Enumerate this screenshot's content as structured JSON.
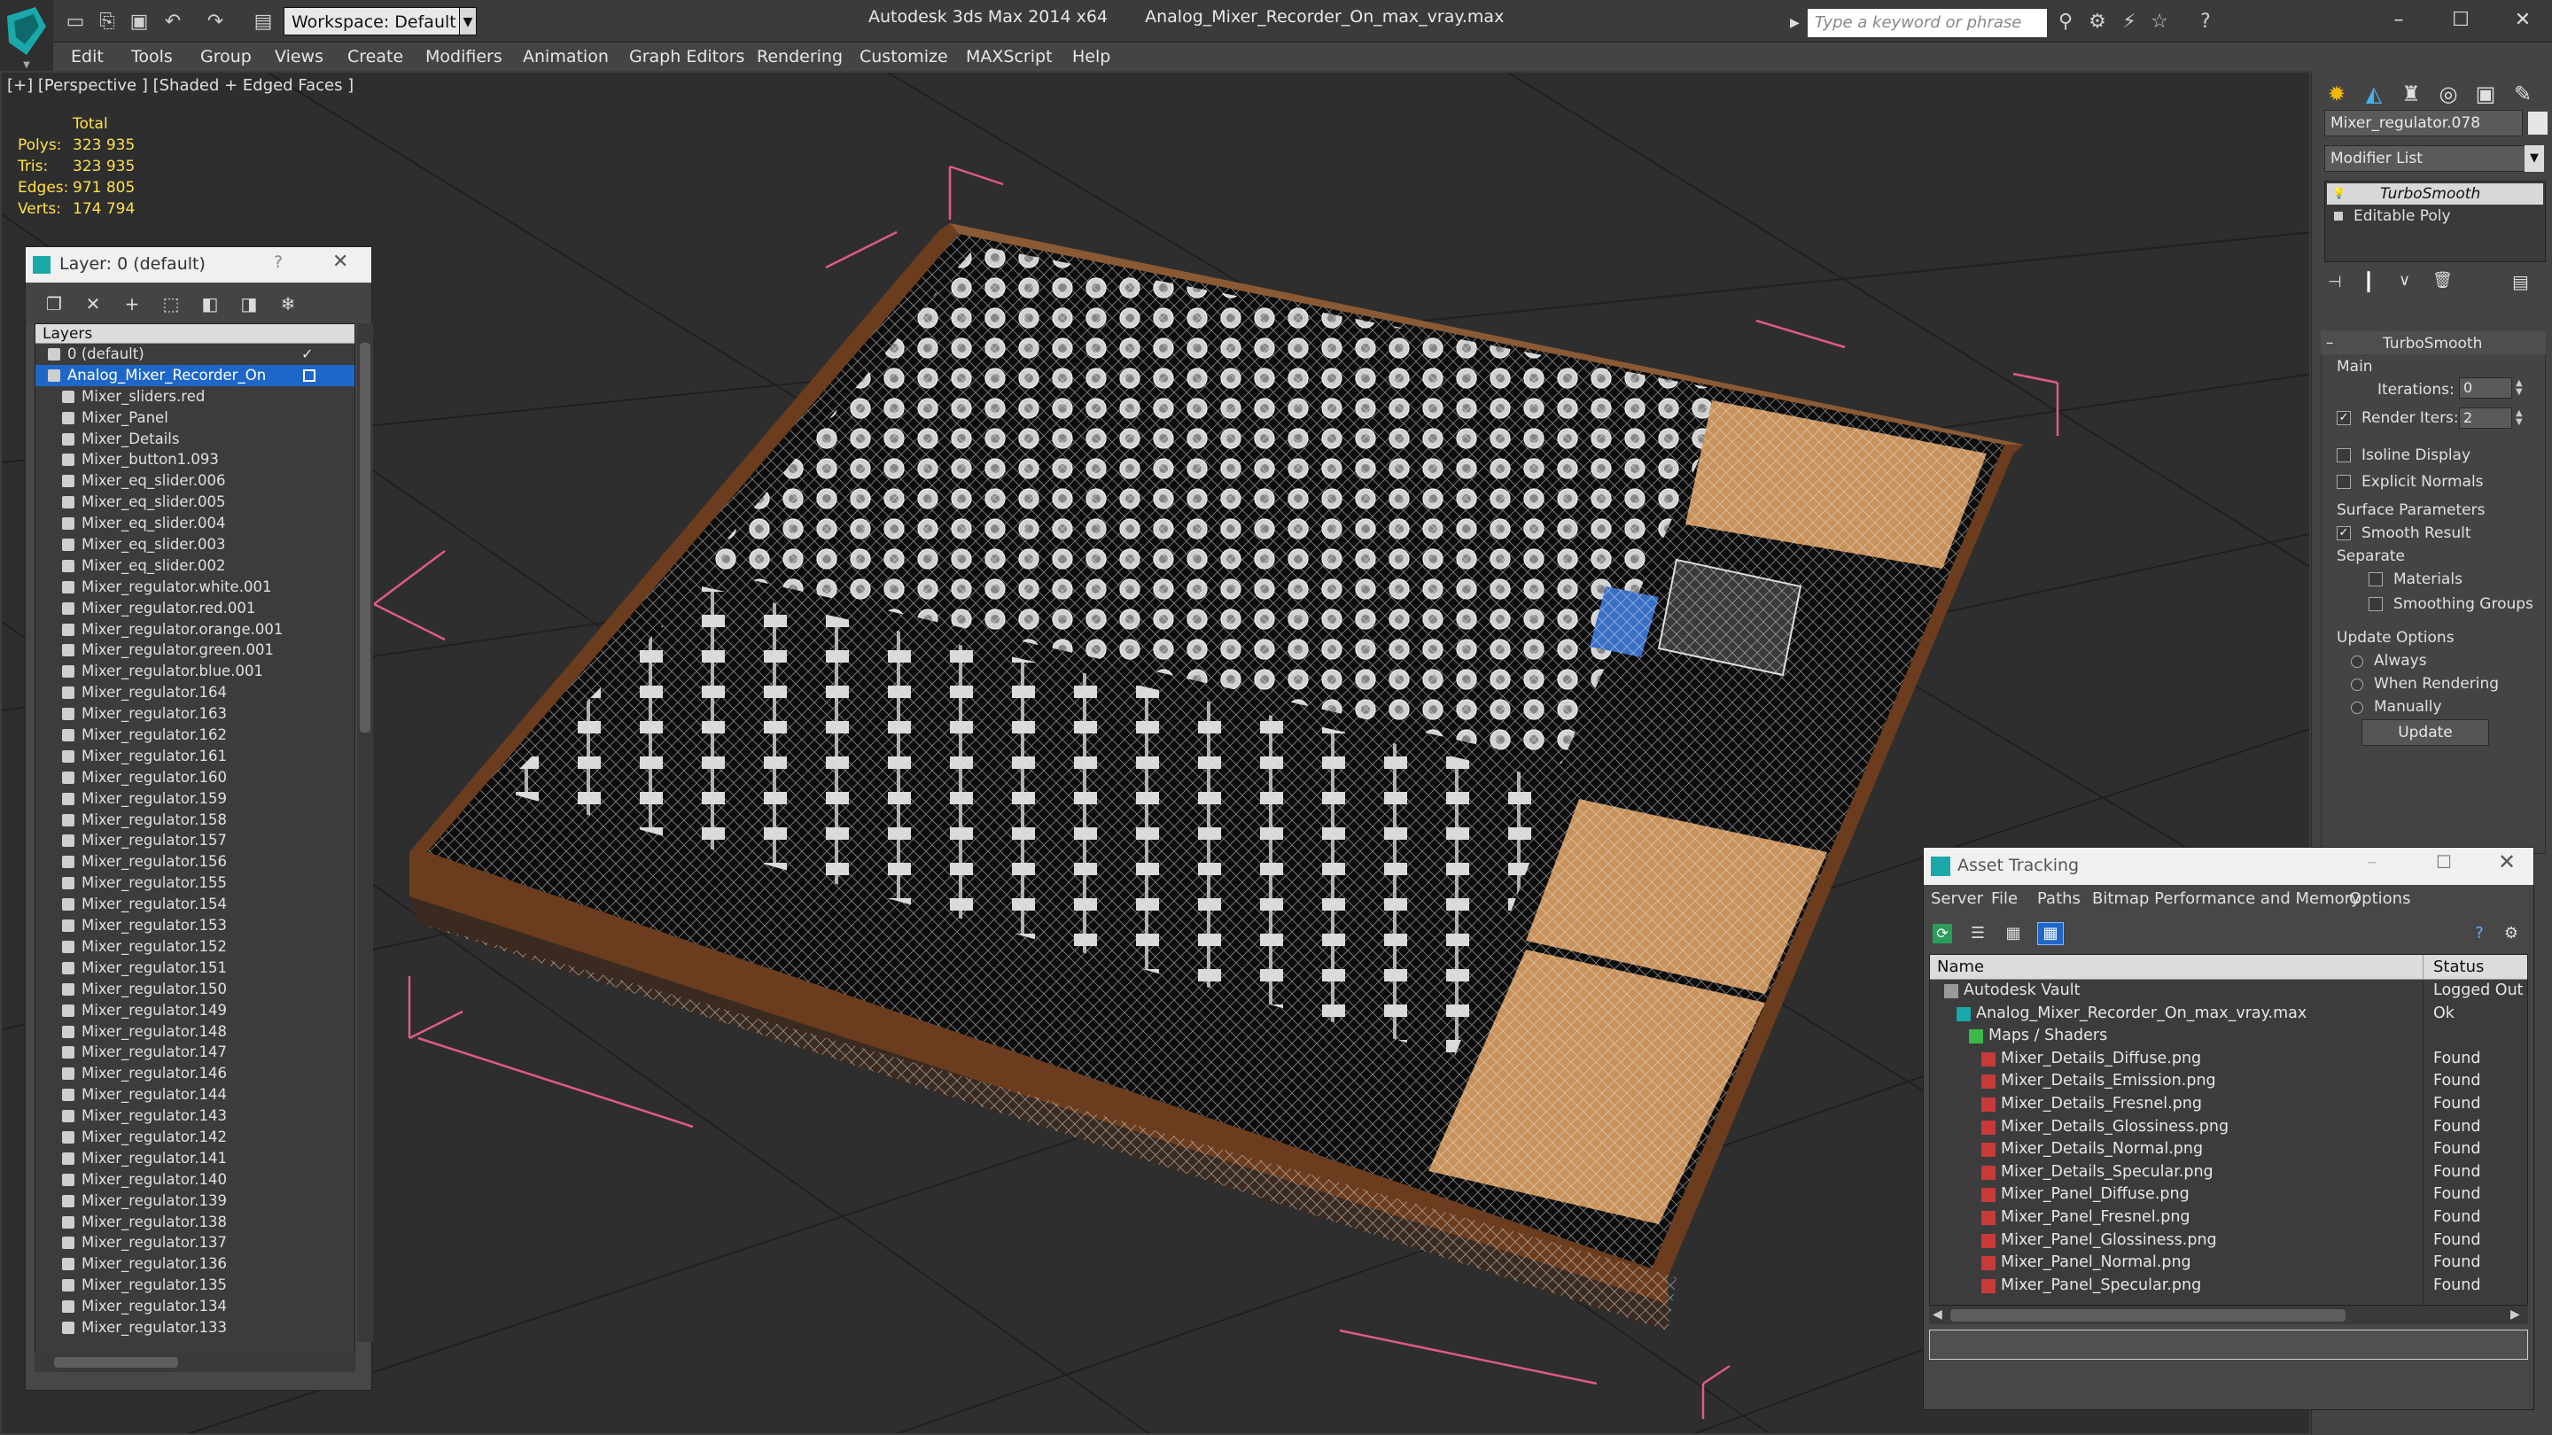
{
  "titlebar": {
    "workspace": "Workspace: Default",
    "app_name": "Autodesk 3ds Max 2014 x64",
    "file_name": "Analog_Mixer_Recorder_On_max_vray.max",
    "search_placeholder": "Type a keyword or phrase"
  },
  "menu": [
    "Edit",
    "Tools",
    "Group",
    "Views",
    "Create",
    "Modifiers",
    "Animation",
    "Graph Editors",
    "Rendering",
    "Customize",
    "MAXScript",
    "Help"
  ],
  "viewport": {
    "label": "[+] [Perspective ] [Shaded + Edged Faces ]",
    "stats": {
      "header": "Total",
      "rows": [
        {
          "label": "Polys:",
          "value": "323 935"
        },
        {
          "label": "Tris:",
          "value": "323 935"
        },
        {
          "label": "Edges:",
          "value": "971 805"
        },
        {
          "label": "Verts:",
          "value": "174 794"
        }
      ]
    }
  },
  "layer_panel": {
    "title": "Layer: 0 (default)",
    "help": "?",
    "close": "✕",
    "column": "Layers",
    "layers": [
      {
        "name": "0 (default)",
        "level": 1
      },
      {
        "name": "Analog_Mixer_Recorder_On",
        "level": 1,
        "selected": true
      },
      {
        "name": "Mixer_sliders.red",
        "level": 2
      },
      {
        "name": "Mixer_Panel",
        "level": 2
      },
      {
        "name": "Mixer_Details",
        "level": 2
      },
      {
        "name": "Mixer_button1.093",
        "level": 2
      },
      {
        "name": "Mixer_eq_slider.006",
        "level": 2
      },
      {
        "name": "Mixer_eq_slider.005",
        "level": 2
      },
      {
        "name": "Mixer_eq_slider.004",
        "level": 2
      },
      {
        "name": "Mixer_eq_slider.003",
        "level": 2
      },
      {
        "name": "Mixer_eq_slider.002",
        "level": 2
      },
      {
        "name": "Mixer_regulator.white.001",
        "level": 2
      },
      {
        "name": "Mixer_regulator.red.001",
        "level": 2
      },
      {
        "name": "Mixer_regulator.orange.001",
        "level": 2
      },
      {
        "name": "Mixer_regulator.green.001",
        "level": 2
      },
      {
        "name": "Mixer_regulator.blue.001",
        "level": 2
      },
      {
        "name": "Mixer_regulator.164",
        "level": 2
      },
      {
        "name": "Mixer_regulator.163",
        "level": 2
      },
      {
        "name": "Mixer_regulator.162",
        "level": 2
      },
      {
        "name": "Mixer_regulator.161",
        "level": 2
      },
      {
        "name": "Mixer_regulator.160",
        "level": 2
      },
      {
        "name": "Mixer_regulator.159",
        "level": 2
      },
      {
        "name": "Mixer_regulator.158",
        "level": 2
      },
      {
        "name": "Mixer_regulator.157",
        "level": 2
      },
      {
        "name": "Mixer_regulator.156",
        "level": 2
      },
      {
        "name": "Mixer_regulator.155",
        "level": 2
      },
      {
        "name": "Mixer_regulator.154",
        "level": 2
      },
      {
        "name": "Mixer_regulator.153",
        "level": 2
      },
      {
        "name": "Mixer_regulator.152",
        "level": 2
      },
      {
        "name": "Mixer_regulator.151",
        "level": 2
      },
      {
        "name": "Mixer_regulator.150",
        "level": 2
      },
      {
        "name": "Mixer_regulator.149",
        "level": 2
      },
      {
        "name": "Mixer_regulator.148",
        "level": 2
      },
      {
        "name": "Mixer_regulator.147",
        "level": 2
      },
      {
        "name": "Mixer_regulator.146",
        "level": 2
      },
      {
        "name": "Mixer_regulator.144",
        "level": 2
      },
      {
        "name": "Mixer_regulator.143",
        "level": 2
      },
      {
        "name": "Mixer_regulator.142",
        "level": 2
      },
      {
        "name": "Mixer_regulator.141",
        "level": 2
      },
      {
        "name": "Mixer_regulator.140",
        "level": 2
      },
      {
        "name": "Mixer_regulator.139",
        "level": 2
      },
      {
        "name": "Mixer_regulator.138",
        "level": 2
      },
      {
        "name": "Mixer_regulator.137",
        "level": 2
      },
      {
        "name": "Mixer_regulator.136",
        "level": 2
      },
      {
        "name": "Mixer_regulator.135",
        "level": 2
      },
      {
        "name": "Mixer_regulator.134",
        "level": 2
      },
      {
        "name": "Mixer_regulator.133",
        "level": 2
      }
    ]
  },
  "command_panel": {
    "object_name": "Mixer_regulator.078",
    "modifier_list": "Modifier List",
    "stack": [
      "TurboSmooth",
      "Editable Poly"
    ],
    "rollout_title": "TurboSmooth",
    "main_group": "Main",
    "iterations_label": "Iterations:",
    "iterations_value": "0",
    "render_iters_label": "Render Iters:",
    "render_iters_value": "2",
    "render_iters_checked": true,
    "isoline_label": "Isoline Display",
    "explicit_normals_label": "Explicit Normals",
    "surface_group": "Surface Parameters",
    "smooth_result_label": "Smooth Result",
    "smooth_result_checked": true,
    "separate_label": "Separate",
    "materials_label": "Materials",
    "smoothing_groups_label": "Smoothing Groups",
    "update_group": "Update Options",
    "always_label": "Always",
    "when_rendering_label": "When Rendering",
    "manually_label": "Manually",
    "update_button": "Update"
  },
  "asset_tracking": {
    "title": "Asset Tracking",
    "menu": [
      "Server",
      "File",
      "Paths",
      "Bitmap Performance and Memory",
      "Options"
    ],
    "columns": [
      "Name",
      "Status"
    ],
    "rows": [
      {
        "name": "Autodesk Vault",
        "status": "Logged Out ...",
        "level": 0,
        "icon": "vault"
      },
      {
        "name": "Analog_Mixer_Recorder_On_max_vray.max",
        "status": "Ok",
        "level": 1,
        "icon": "max"
      },
      {
        "name": "Maps / Shaders",
        "status": "",
        "level": 2,
        "icon": "maps"
      },
      {
        "name": "Mixer_Details_Diffuse.png",
        "status": "Found",
        "level": 3,
        "icon": "png"
      },
      {
        "name": "Mixer_Details_Emission.png",
        "status": "Found",
        "level": 3,
        "icon": "png"
      },
      {
        "name": "Mixer_Details_Fresnel.png",
        "status": "Found",
        "level": 3,
        "icon": "png"
      },
      {
        "name": "Mixer_Details_Glossiness.png",
        "status": "Found",
        "level": 3,
        "icon": "png"
      },
      {
        "name": "Mixer_Details_Normal.png",
        "status": "Found",
        "level": 3,
        "icon": "png"
      },
      {
        "name": "Mixer_Details_Specular.png",
        "status": "Found",
        "level": 3,
        "icon": "png"
      },
      {
        "name": "Mixer_Panel_Diffuse.png",
        "status": "Found",
        "level": 3,
        "icon": "png"
      },
      {
        "name": "Mixer_Panel_Fresnel.png",
        "status": "Found",
        "level": 3,
        "icon": "png"
      },
      {
        "name": "Mixer_Panel_Glossiness.png",
        "status": "Found",
        "level": 3,
        "icon": "png"
      },
      {
        "name": "Mixer_Panel_Normal.png",
        "status": "Found",
        "level": 3,
        "icon": "png"
      },
      {
        "name": "Mixer_Panel_Specular.png",
        "status": "Found",
        "level": 3,
        "icon": "png"
      }
    ]
  },
  "colors": {
    "selection": "#1e67c9",
    "stats": "#ffe14a",
    "wood": "#6b3d1e",
    "panel_tan": "#c8925a"
  }
}
